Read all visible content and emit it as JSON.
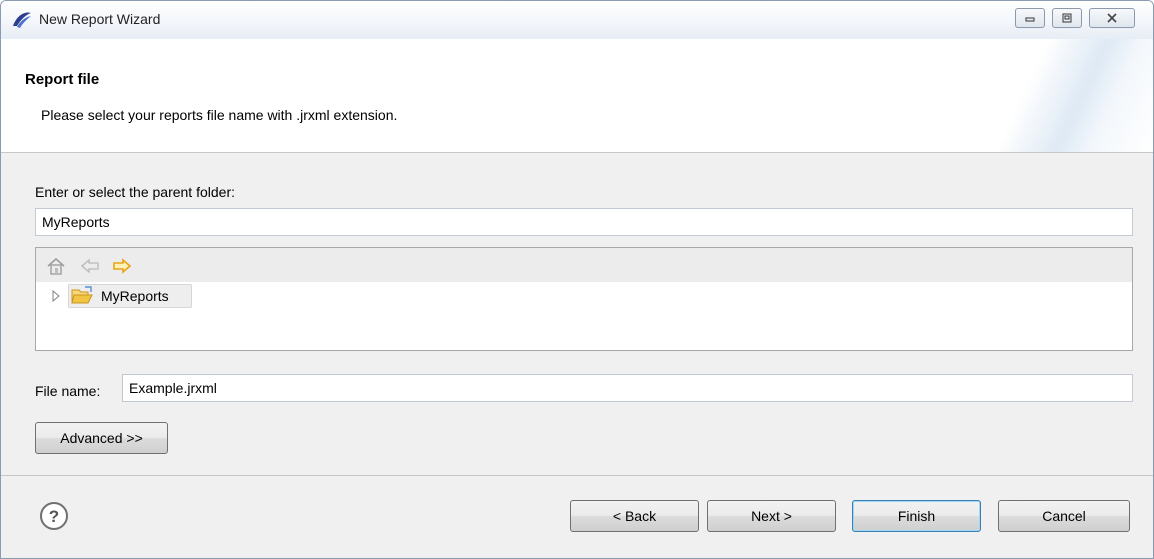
{
  "window": {
    "title": "New Report Wizard"
  },
  "header": {
    "title": "Report file",
    "description": "Please select your reports file name with .jrxml extension."
  },
  "folder": {
    "label": "Enter or select the parent folder:",
    "value": "MyReports"
  },
  "tree": {
    "items": [
      {
        "label": "MyReports",
        "expanded": false
      }
    ]
  },
  "file": {
    "label": "File name:",
    "value": "Example.jrxml"
  },
  "buttons": {
    "advanced": "Advanced >>",
    "back": "< Back",
    "next": "Next >",
    "finish": "Finish",
    "cancel": "Cancel"
  },
  "icons": {
    "app": "eclipse-swoosh-icon",
    "home": "home-icon",
    "back": "back-arrow-icon",
    "forward": "forward-arrow-icon",
    "folder": "open-folder-icon",
    "help": "help-icon"
  },
  "colors": {
    "accent": "#3c7fb1",
    "forward_arrow": "#e8a317",
    "folder": "#f2c443"
  }
}
